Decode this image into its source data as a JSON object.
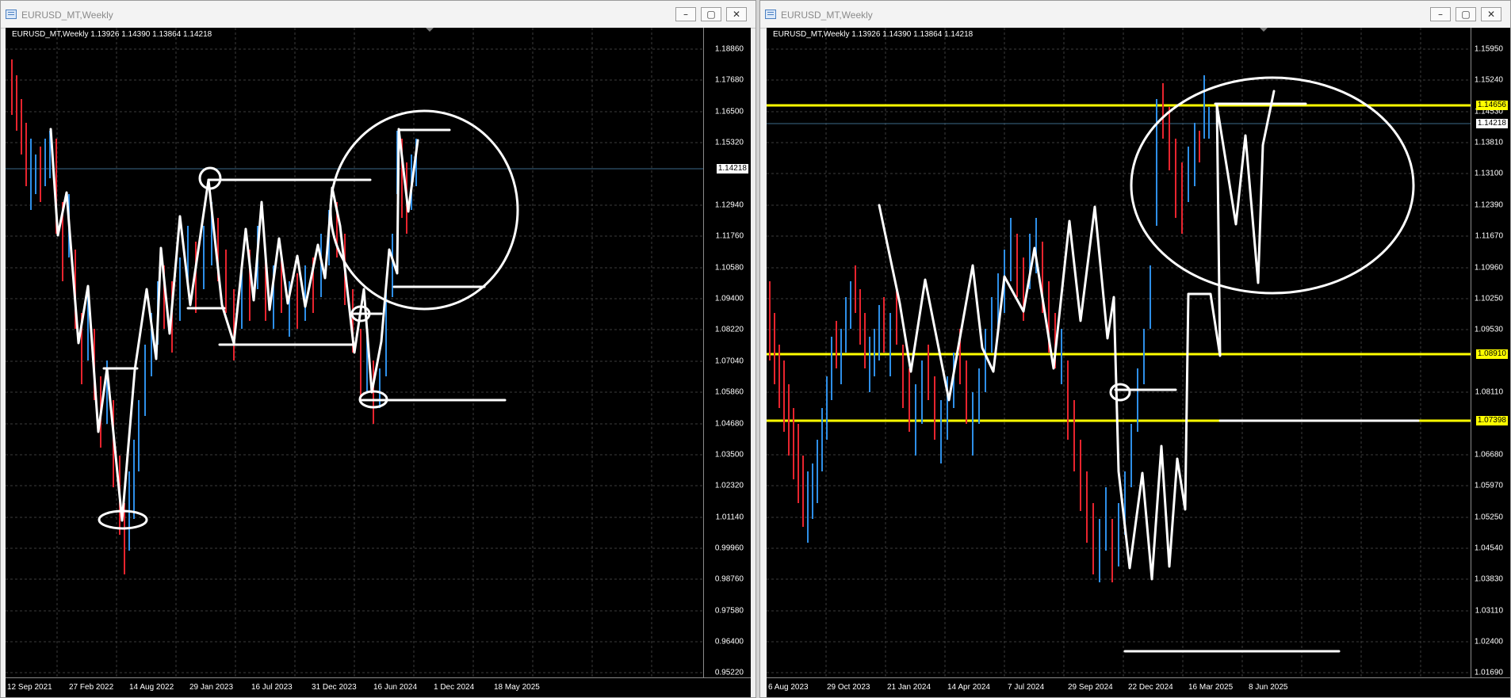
{
  "windows": [
    {
      "title": "EURUSD_MT,Weekly",
      "ohlc": "EURUSD_MT,Weekly  1.13926 1.14390 1.13864 1.14218",
      "buttons": {
        "minimize": "–",
        "restore": "▢",
        "close": "✕"
      },
      "price_labels": [
        "1.18860",
        "1.17680",
        "1.16500",
        "1.15320",
        "1.12940",
        "1.11760",
        "1.10580",
        "1.09400",
        "1.08220",
        "1.07040",
        "1.05860",
        "1.04680",
        "1.03500",
        "1.02320",
        "1.01140",
        "0.99960",
        "0.98760",
        "0.97580",
        "0.96400",
        "0.95220"
      ],
      "current_price": "1.14218",
      "date_labels": [
        "12 Sep 2021",
        "27 Feb 2022",
        "14 Aug 2022",
        "29 Jan 2023",
        "16 Jul 2023",
        "31 Dec 2023",
        "16 Jun 2024",
        "1 Dec 2024",
        "18 May 2025"
      ]
    },
    {
      "title": "EURUSD_MT,Weekly",
      "ohlc": "EURUSD_MT,Weekly  1.13926 1.14390 1.13864 1.14218",
      "buttons": {
        "minimize": "–",
        "restore": "▢",
        "close": "✕"
      },
      "price_labels": [
        "1.15950",
        "1.15240",
        "1.14530",
        "1.13810",
        "1.13100",
        "1.12390",
        "1.11670",
        "1.10960",
        "1.10250",
        "1.09530",
        "1.08110",
        "1.06680",
        "1.05970",
        "1.05250",
        "1.04540",
        "1.03830",
        "1.03110",
        "1.02400",
        "1.01690"
      ],
      "current_price": "1.14218",
      "level_labels": [
        "1.14656",
        "1.08910",
        "1.07398"
      ],
      "date_labels": [
        "6 Aug 2023",
        "29 Oct 2023",
        "21 Jan 2024",
        "14 Apr 2024",
        "7 Jul 2024",
        "29 Sep 2024",
        "22 Dec 2024",
        "16 Mar 2025",
        "8 Jun 2025"
      ]
    }
  ],
  "colors": {
    "bull": "#2e8fe8",
    "bear": "#e8242e",
    "level": "#ffff00",
    "drawing": "#ffffff",
    "grid": "#3c3c3c"
  }
}
